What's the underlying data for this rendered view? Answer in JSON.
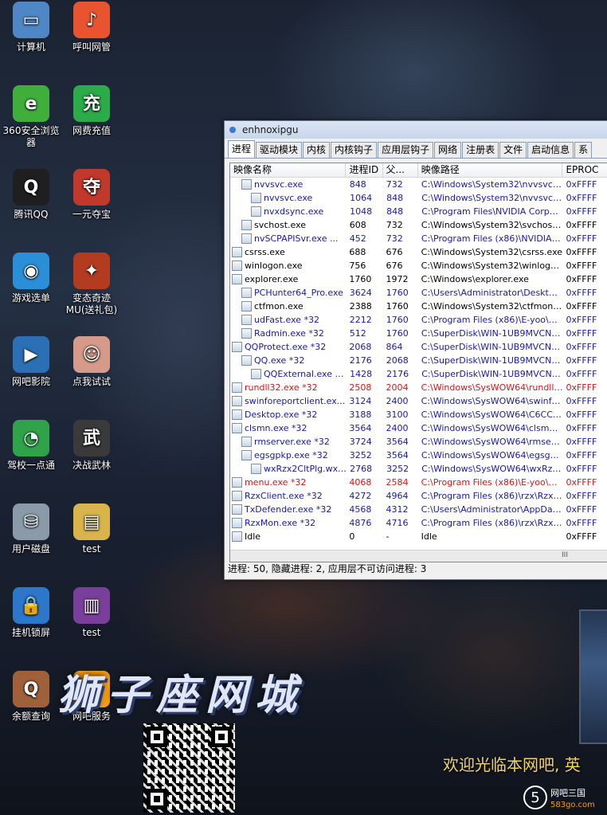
{
  "desktop": {
    "icons": [
      {
        "label": "计算机",
        "glyph": "▭",
        "color": "#4f86c6",
        "icon": "computer-icon"
      },
      {
        "label": "呼叫网管",
        "glyph": "♪",
        "color": "#e8542f",
        "icon": "mic-icon"
      },
      {
        "label": "360安全浏览器",
        "glyph": "e",
        "color": "#3fae3a",
        "icon": "browser-360-icon"
      },
      {
        "label": "网费充值",
        "glyph": "充",
        "color": "#2bab4a",
        "icon": "recharge-icon"
      },
      {
        "label": "腾讯QQ",
        "glyph": "Q",
        "color": "#1f1f1f",
        "icon": "qq-icon"
      },
      {
        "label": "一元夺宝",
        "glyph": "夺",
        "color": "#c0392b",
        "icon": "treasure-icon"
      },
      {
        "label": "游戏选单",
        "glyph": "◉",
        "color": "#2a8fd6",
        "icon": "game-menu-icon"
      },
      {
        "label": "变态奇迹MU(送礼包)",
        "glyph": "✦",
        "color": "#b33b1f",
        "icon": "mu-game-icon"
      },
      {
        "label": "网吧影院",
        "glyph": "▶",
        "color": "#2b6fb5",
        "icon": "cinema-icon"
      },
      {
        "label": "点我试试",
        "glyph": "☺",
        "color": "#d69a8a",
        "icon": "try-me-icon"
      },
      {
        "label": "驾校一点通",
        "glyph": "◔",
        "color": "#2fa24a",
        "icon": "driving-school-icon"
      },
      {
        "label": "决战武林",
        "glyph": "武",
        "color": "#3a3a3a",
        "icon": "wulin-game-icon"
      },
      {
        "label": "用户磁盘",
        "glyph": "⛁",
        "color": "#8a9aa8",
        "icon": "disk-icon"
      },
      {
        "label": "test",
        "glyph": "▤",
        "color": "#d8b44a",
        "icon": "folder-icon"
      },
      {
        "label": "挂机锁屏",
        "glyph": "🔒",
        "color": "#2c77c9",
        "icon": "lock-screen-icon"
      },
      {
        "label": "test",
        "glyph": "▥",
        "color": "#7a3f9a",
        "icon": "archive-icon"
      },
      {
        "label": "余额查询",
        "glyph": "Q",
        "color": "#a0603a",
        "icon": "balance-query-icon"
      },
      {
        "label": "网吧服务",
        "glyph": "♛",
        "color": "#f39c12",
        "icon": "service-icon"
      }
    ],
    "banner": "狮子座网城",
    "welcome": "欢迎光临本网吧, 英",
    "logo": {
      "mark": "5",
      "name": "网吧三国",
      "site": "583go.com"
    }
  },
  "window": {
    "title": "enhnoxipgu",
    "tabs": [
      "进程",
      "驱动模块",
      "内核",
      "内核钩子",
      "应用层钩子",
      "网络",
      "注册表",
      "文件",
      "启动信息",
      "系"
    ],
    "columns": [
      "映像名称",
      "进程ID",
      "父...",
      "映像路径",
      "EPROC"
    ],
    "rows": [
      {
        "name": "nvvsvc.exe",
        "pid": "848",
        "ppid": "732",
        "path": "C:\\Windows\\System32\\nvvsvc.exe",
        "ep": "0xFFFF",
        "indent": 1,
        "color": "#1a1aa0"
      },
      {
        "name": "nvvsvc.exe",
        "pid": "1064",
        "ppid": "848",
        "path": "C:\\Windows\\System32\\nvvsvc.exe",
        "ep": "0xFFFF",
        "indent": 2,
        "color": "#1a1aa0"
      },
      {
        "name": "nvxdsync.exe",
        "pid": "1048",
        "ppid": "848",
        "path": "C:\\Program Files\\NVIDIA Corporati...",
        "ep": "0xFFFF",
        "indent": 2,
        "color": "#1a1aa0"
      },
      {
        "name": "svchost.exe",
        "pid": "608",
        "ppid": "732",
        "path": "C:\\Windows\\System32\\svchost.exe",
        "ep": "0xFFFF",
        "indent": 1,
        "color": "#000000"
      },
      {
        "name": "nvSCPAPISvr.exe ...",
        "pid": "452",
        "ppid": "732",
        "path": "C:\\Program Files (x86)\\NVIDIA Co...",
        "ep": "0xFFFF",
        "indent": 1,
        "color": "#1a1aa0"
      },
      {
        "name": "csrss.exe",
        "pid": "688",
        "ppid": "676",
        "path": "C:\\Windows\\System32\\csrss.exe",
        "ep": "0xFFFF",
        "indent": 0,
        "color": "#000000"
      },
      {
        "name": "winlogon.exe",
        "pid": "756",
        "ppid": "676",
        "path": "C:\\Windows\\System32\\winlogon.exe",
        "ep": "0xFFFF",
        "indent": 0,
        "color": "#000000"
      },
      {
        "name": "explorer.exe",
        "pid": "1760",
        "ppid": "1972",
        "path": "C:\\Windows\\explorer.exe",
        "ep": "0xFFFF",
        "indent": 0,
        "color": "#000000"
      },
      {
        "name": "PCHunter64_Pro.exe",
        "pid": "3624",
        "ppid": "1760",
        "path": "C:\\Users\\Administrator\\Desktop\\t...",
        "ep": "0xFFFF",
        "indent": 1,
        "color": "#1a1aa0"
      },
      {
        "name": "ctfmon.exe",
        "pid": "2388",
        "ppid": "1760",
        "path": "C:\\Windows\\System32\\ctfmon.exe",
        "ep": "0xFFFF",
        "indent": 1,
        "color": "#000000"
      },
      {
        "name": "udFast.exe *32",
        "pid": "2212",
        "ppid": "1760",
        "path": "C:\\Program Files (x86)\\E-yoo\\udF...",
        "ep": "0xFFFF",
        "indent": 1,
        "color": "#1a1aa0"
      },
      {
        "name": "Radmin.exe *32",
        "pid": "512",
        "ppid": "1760",
        "path": "C:\\SuperDisk\\WIN-1UB9MVCN6Q-...",
        "ep": "0xFFFF",
        "indent": 1,
        "color": "#1a1aa0"
      },
      {
        "name": "QQProtect.exe *32",
        "pid": "2068",
        "ppid": "864",
        "path": "C:\\SuperDisk\\WIN-1UB9MVCN6Q-...",
        "ep": "0xFFFF",
        "indent": 0,
        "color": "#1a1aa0"
      },
      {
        "name": "QQ.exe *32",
        "pid": "2176",
        "ppid": "2068",
        "path": "C:\\SuperDisk\\WIN-1UB9MVCN6Q-...",
        "ep": "0xFFFF",
        "indent": 1,
        "color": "#1a1aa0"
      },
      {
        "name": "QQExternal.exe *32",
        "pid": "1428",
        "ppid": "2176",
        "path": "C:\\SuperDisk\\WIN-1UB9MVCN6Q-...",
        "ep": "0xFFFF",
        "indent": 2,
        "color": "#1a1aa0"
      },
      {
        "name": "rundll32.exe *32",
        "pid": "2508",
        "ppid": "2004",
        "path": "C:\\Windows\\SysWOW64\\rundll32....",
        "ep": "0xFFFF",
        "indent": 0,
        "color": "#d01818"
      },
      {
        "name": "swinforeportclient.exe *32",
        "pid": "3124",
        "ppid": "2400",
        "path": "C:\\Windows\\SysWOW64\\swinfore...",
        "ep": "0xFFFF",
        "indent": 0,
        "color": "#1a1aa0"
      },
      {
        "name": "Desktop.exe *32",
        "pid": "3188",
        "ppid": "3100",
        "path": "C:\\Windows\\SysWOW64\\C6CC01...",
        "ep": "0xFFFF",
        "indent": 0,
        "color": "#1a1aa0"
      },
      {
        "name": "clsmn.exe *32",
        "pid": "3564",
        "ppid": "2400",
        "path": "C:\\Windows\\SysWOW64\\clsmn.exe",
        "ep": "0xFFFF",
        "indent": 0,
        "color": "#1a1aa0"
      },
      {
        "name": "rmserver.exe *32",
        "pid": "3724",
        "ppid": "3564",
        "path": "C:\\Windows\\SysWOW64\\rmserver...",
        "ep": "0xFFFF",
        "indent": 1,
        "color": "#1a1aa0"
      },
      {
        "name": "egsgpkp.exe *32",
        "pid": "3252",
        "ppid": "3564",
        "path": "C:\\Windows\\SysWOW64\\egsgpkp....",
        "ep": "0xFFFF",
        "indent": 1,
        "color": "#1a1aa0"
      },
      {
        "name": "wxRzx2CltPlg.wxe ...",
        "pid": "2768",
        "ppid": "3252",
        "path": "C:\\Windows\\SysWOW64\\wxRzx2...",
        "ep": "0xFFFF",
        "indent": 2,
        "color": "#1a1aa0"
      },
      {
        "name": "menu.exe *32",
        "pid": "4068",
        "ppid": "2584",
        "path": "C:\\Program Files (x86)\\E-yoo\\men...",
        "ep": "0xFFFF",
        "indent": 0,
        "color": "#d01818"
      },
      {
        "name": "RzxClient.exe *32",
        "pid": "4272",
        "ppid": "4964",
        "path": "C:\\Program Files (x86)\\rzx\\RzxClie...",
        "ep": "0xFFFF",
        "indent": 0,
        "color": "#1a1aa0"
      },
      {
        "name": "TxDefender.exe *32",
        "pid": "4568",
        "ppid": "4312",
        "path": "C:\\Users\\Administrator\\AppData\\L...",
        "ep": "0xFFFF",
        "indent": 0,
        "color": "#1a1aa0"
      },
      {
        "name": "RzxMon.exe *32",
        "pid": "4876",
        "ppid": "4716",
        "path": "C:\\Program Files (x86)\\rzx\\RzxMo...",
        "ep": "0xFFFF",
        "indent": 0,
        "color": "#1a1aa0"
      },
      {
        "name": "Idle",
        "pid": "0",
        "ppid": "-",
        "path": "Idle",
        "ep": "0xFFFF",
        "indent": 0,
        "color": "#000000"
      }
    ],
    "scroll_marker": "III",
    "status": "进程: 50, 隐藏进程: 2, 应用层不可访问进程: 3"
  }
}
